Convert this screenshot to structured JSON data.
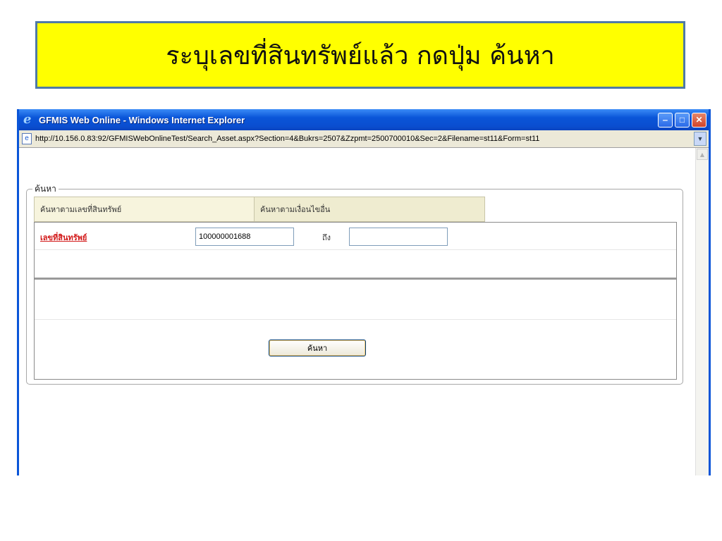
{
  "slide": {
    "title": "ระบุเลขที่สินทรัพย์แล้ว กดปุ่ม ค้นหา"
  },
  "window": {
    "title": "GFMIS Web Online - Windows Internet Explorer",
    "url": "http://10.156.0.83:92/GFMISWebOnlineTest/Search_Asset.aspx?Section=4&Bukrs=2507&Zzpmt=2500700010&Sec=2&Filename=st11&Form=st11",
    "minimize_glyph": "‒",
    "maximize_glyph": "□",
    "close_glyph": "✕"
  },
  "search_form": {
    "legend": "ค้นหา",
    "tabs": [
      {
        "label": "ค้นหาตามเลขที่สินทรัพย์"
      },
      {
        "label": "ค้นหาตามเงื่อนไขอื่น"
      }
    ],
    "asset_label": "เลขที่สินทรัพย์",
    "asset_from_value": "100000001688",
    "to_label": "ถึง",
    "asset_to_value": "",
    "search_button": "ค้นหา"
  },
  "icons": {
    "ie_logo": "ie-logo-icon",
    "page": "page-icon",
    "scroll_up": "scroll-up-arrow-icon"
  }
}
